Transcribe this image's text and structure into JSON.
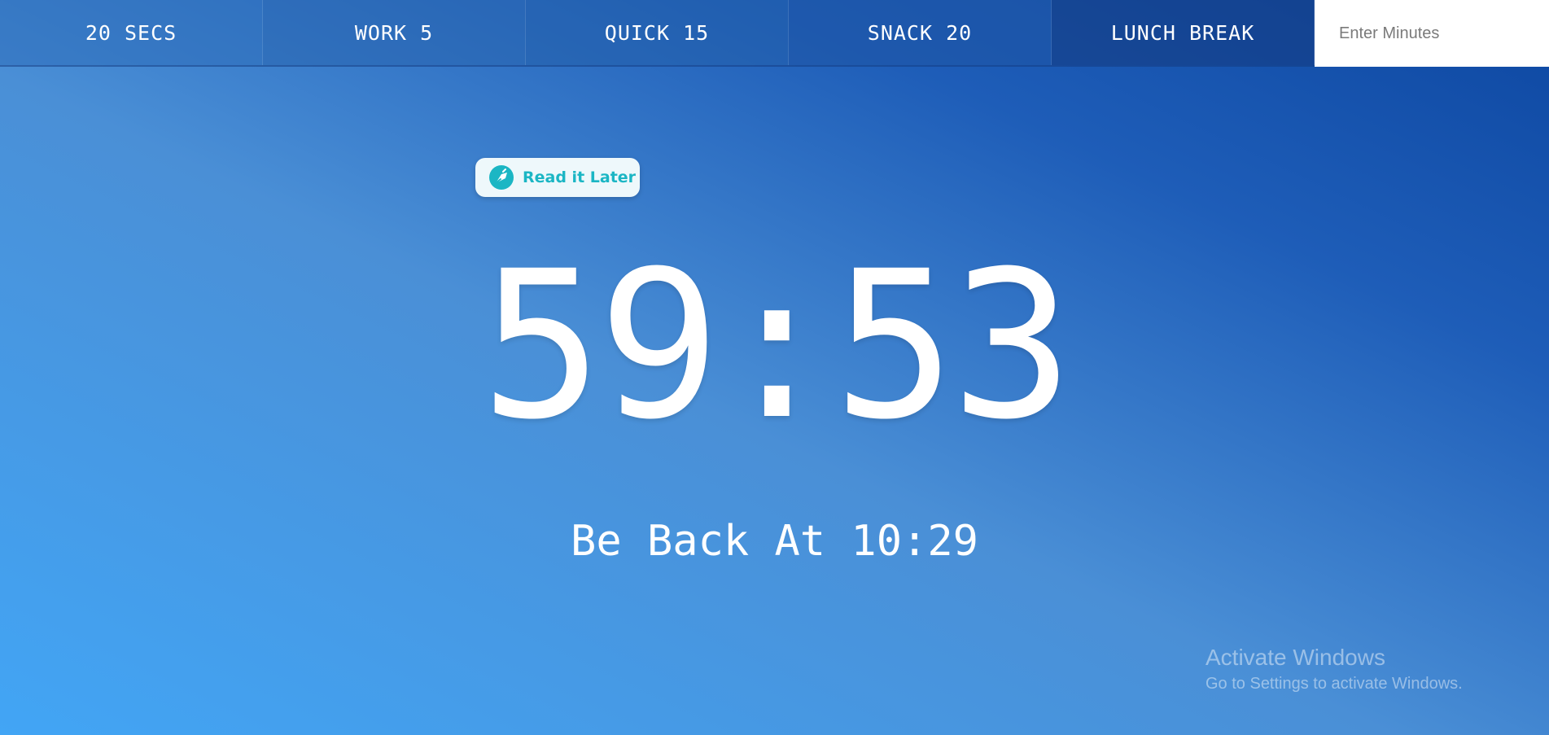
{
  "nav": {
    "buttons": [
      {
        "label": "20 SECS"
      },
      {
        "label": "WORK 5"
      },
      {
        "label": "QUICK 15"
      },
      {
        "label": "SNACK 20"
      },
      {
        "label": "LUNCH BREAK"
      }
    ],
    "minutes_input": {
      "placeholder": "Enter Minutes",
      "value": ""
    }
  },
  "read_later": {
    "label": "Read it Later",
    "icon": "read-it-later-icon",
    "accent_color": "#1bb6c4"
  },
  "timer": {
    "display": "59:53"
  },
  "end_time": {
    "text": "Be Back At 10:29"
  },
  "watermark": {
    "title": "Activate Windows",
    "subtitle": "Go to Settings to activate Windows."
  },
  "colors": {
    "background_start": "#42a5f5",
    "background_end": "#0d47a1",
    "text": "#ffffff",
    "input_background": "#ffffff"
  }
}
